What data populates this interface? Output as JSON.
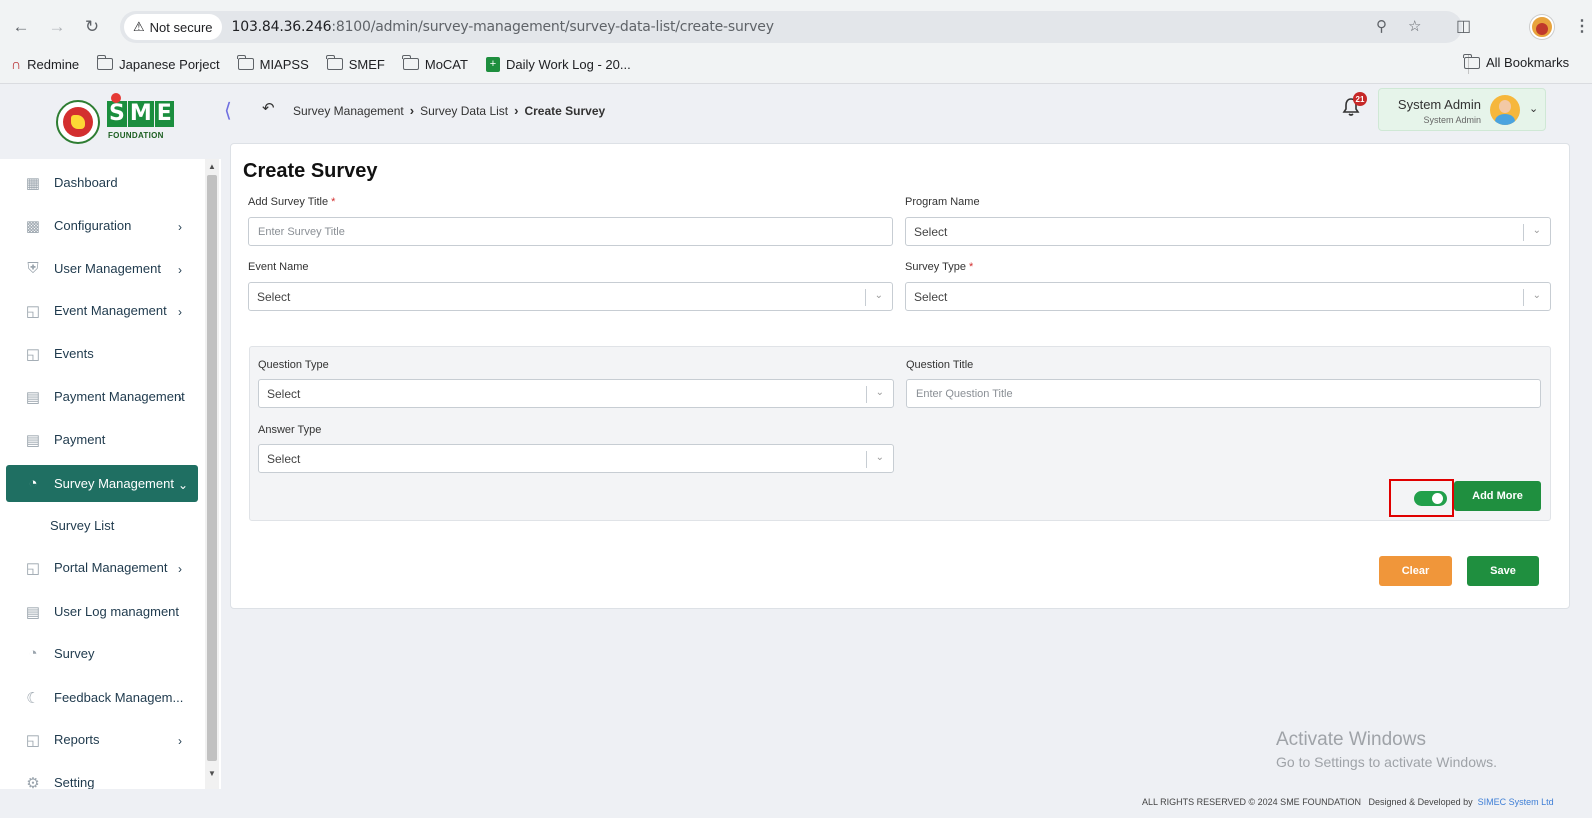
{
  "browser": {
    "not_secure_label": "Not secure",
    "url_host": "103.84.36.246",
    "url_rest": ":8100/admin/survey-management/survey-data-list/create-survey",
    "bookmarks": [
      {
        "label": "Redmine",
        "icon": "redmine-icon"
      },
      {
        "label": "Japanese Porject",
        "icon": "folder-icon"
      },
      {
        "label": "MIAPSS",
        "icon": "folder-icon"
      },
      {
        "label": "SMEF",
        "icon": "folder-icon"
      },
      {
        "label": "MoCAT",
        "icon": "folder-icon"
      },
      {
        "label": "Daily Work Log - 20...",
        "icon": "sheets-icon"
      }
    ],
    "all_bookmarks_label": "All Bookmarks"
  },
  "logo": {
    "letters": [
      "S",
      "M",
      "E"
    ],
    "foundation": "FOUNDATION"
  },
  "header": {
    "breadcrumb": [
      "Survey Management",
      "Survey Data List",
      "Create Survey"
    ],
    "notification_count": "21",
    "user_name": "System Admin",
    "user_role": "System Admin"
  },
  "sidebar": {
    "items": [
      {
        "label": "Dashboard",
        "icon": "dashboard-icon",
        "has_arrow": false
      },
      {
        "label": "Configuration",
        "icon": "configuration-icon",
        "has_arrow": true
      },
      {
        "label": "User Management",
        "icon": "user-shield-icon",
        "has_arrow": true
      },
      {
        "label": "Event Management",
        "icon": "lock-icon",
        "has_arrow": true
      },
      {
        "label": "Events",
        "icon": "lock-icon",
        "has_arrow": false
      },
      {
        "label": "Payment Management",
        "icon": "money-icon",
        "has_arrow": true
      },
      {
        "label": "Payment",
        "icon": "money-icon",
        "has_arrow": false
      },
      {
        "label": "Survey Management",
        "icon": "pie-chart-icon",
        "has_arrow": true,
        "active": true
      },
      {
        "label": "Portal Management",
        "icon": "lock-icon",
        "has_arrow": true
      },
      {
        "label": "User Log managment",
        "icon": "money-icon",
        "has_arrow": false
      },
      {
        "label": "Survey",
        "icon": "pie-chart-icon",
        "has_arrow": false
      },
      {
        "label": "Feedback Managem...",
        "icon": "feedback-icon",
        "has_arrow": false
      },
      {
        "label": "Reports",
        "icon": "lock-icon",
        "has_arrow": true
      },
      {
        "label": "Setting",
        "icon": "gear-icon",
        "has_arrow": false
      }
    ],
    "sub_item": "Survey List"
  },
  "form": {
    "title": "Create Survey",
    "survey_title_label": "Add Survey Title",
    "survey_title_placeholder": "Enter Survey Title",
    "program_name_label": "Program Name",
    "program_name_value": "Select",
    "event_name_label": "Event Name",
    "event_name_value": "Select",
    "survey_type_label": "Survey Type",
    "survey_type_value": "Select",
    "required_mark": "*",
    "question_type_label": "Question Type",
    "question_type_value": "Select",
    "question_title_label": "Question Title",
    "question_title_placeholder": "Enter Question Title",
    "answer_type_label": "Answer Type",
    "answer_type_value": "Select",
    "toggle_on": true,
    "add_more_label": "Add More",
    "clear_label": "Clear",
    "save_label": "Save"
  },
  "colors": {
    "accent": "#1f6f62",
    "primary_button": "#1f8f3f",
    "clear_button": "#f0963a",
    "highlight_border": "#e00000"
  },
  "watermark": {
    "line1": "Activate Windows",
    "line2": "Go to Settings to activate Windows."
  },
  "footer": {
    "rights": "ALL RIGHTS RESERVED © 2024 SME FOUNDATION",
    "designed": "Designed & Developed by",
    "company": "SIMEC System Ltd"
  }
}
